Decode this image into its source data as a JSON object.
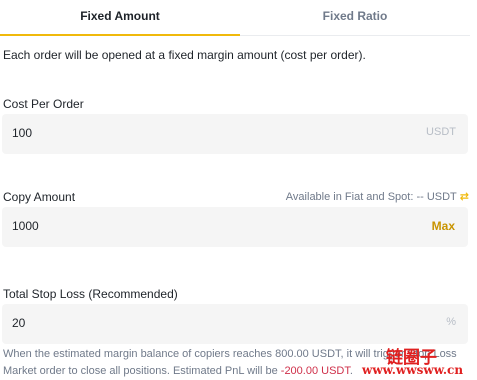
{
  "tabs": {
    "fixed_amount": "Fixed Amount",
    "fixed_ratio": "Fixed Ratio"
  },
  "description": "Each order will be opened at a fixed margin amount (cost per order).",
  "cost_per_order": {
    "label": "Cost Per Order",
    "value": "100",
    "unit": "USDT"
  },
  "copy_amount": {
    "label": "Copy Amount",
    "available_text": "Available in Fiat and Spot: -- USDT",
    "value": "1000",
    "max_label": "Max"
  },
  "total_stop_loss": {
    "label": "Total Stop Loss (Recommended)",
    "value": "20",
    "unit": "%"
  },
  "note": {
    "part1": "When the estimated margin balance of copiers reaches ",
    "amount": "800.00 USDT",
    "part2": ", it will trigger Stop Loss Market order to close all positions. Estimated PnL will be ",
    "pnl": "-200.00 USDT",
    "part3": "."
  },
  "watermark": {
    "logo": "链圈子",
    "url": "www.wwsww.cn"
  },
  "colors": {
    "accent": "#f0b90b",
    "max": "#c99400",
    "negative": "#cf304a",
    "watermark": "#e02020"
  }
}
